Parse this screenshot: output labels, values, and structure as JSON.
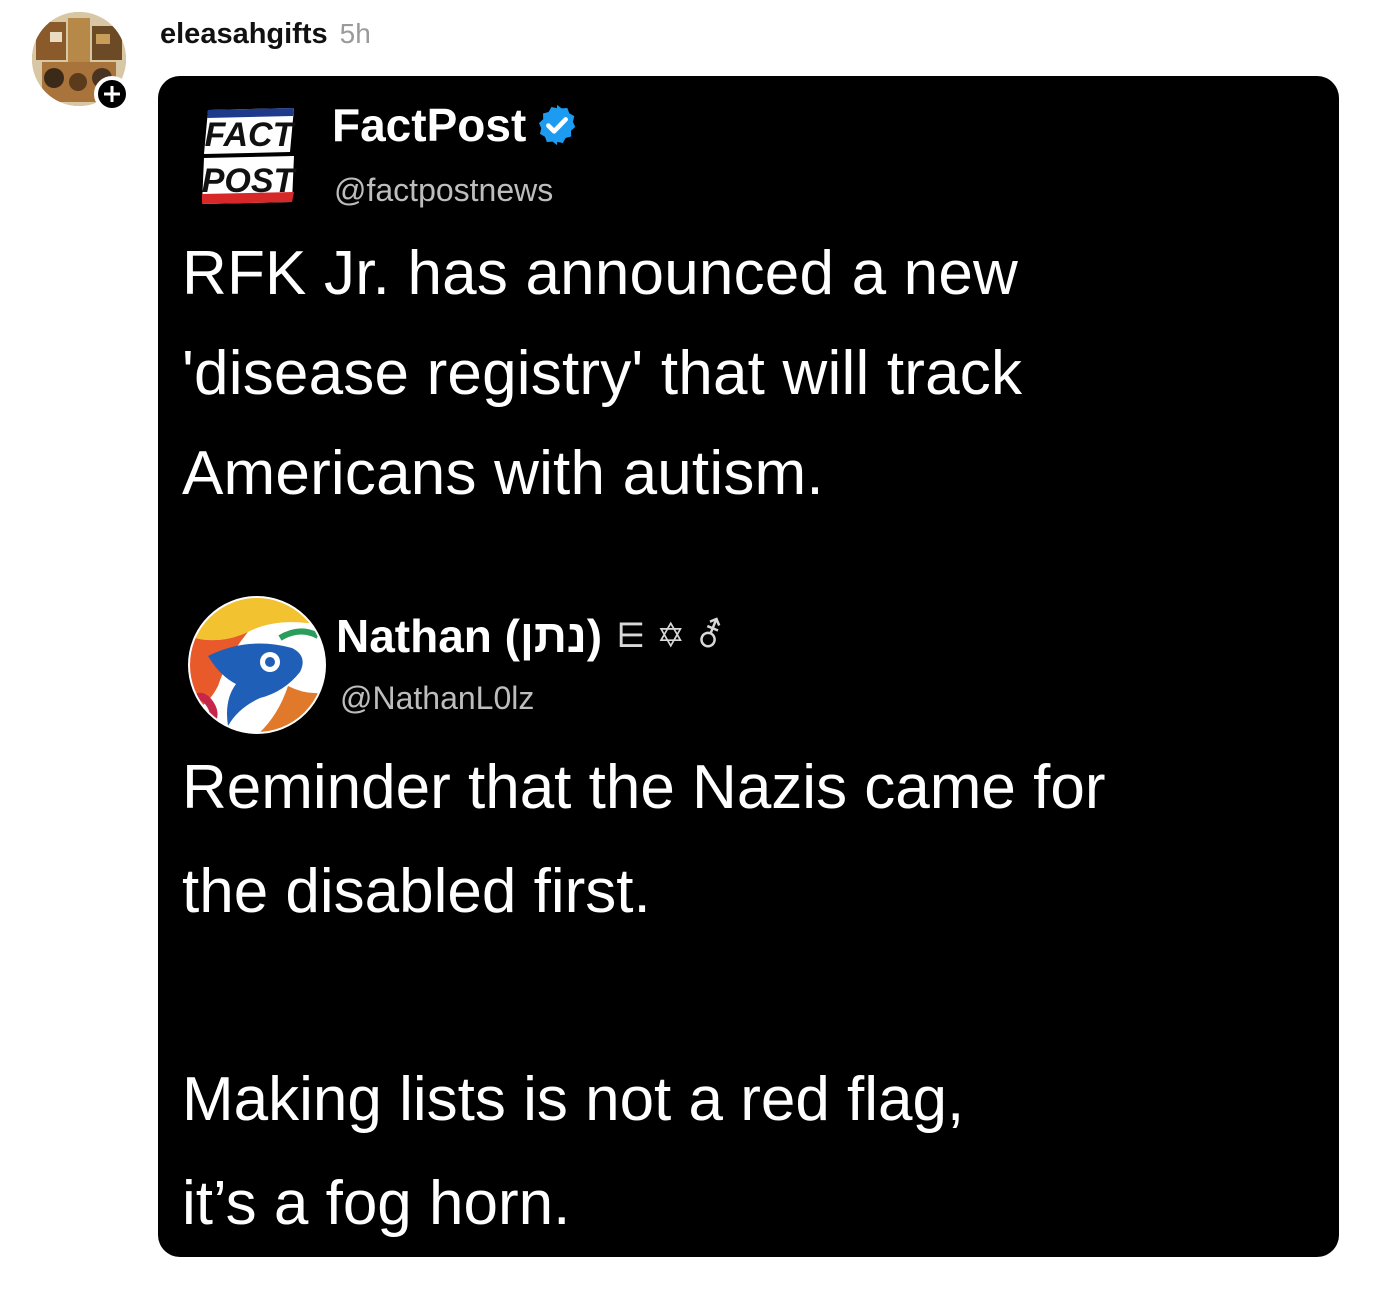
{
  "post": {
    "username": "eleasahgifts",
    "timestamp": "5h",
    "follow_icon": "plus-icon"
  },
  "embedded_image": {
    "first_tweet": {
      "logo_text_line1": "FACT",
      "logo_text_line2": "POST",
      "display_name": "FactPost",
      "verified_icon": "verified-check-icon",
      "handle": "@factpostnews",
      "text_lines": [
        "RFK Jr. has announced a new",
        "'disease registry' that will track",
        "Americans with autism."
      ]
    },
    "second_tweet": {
      "display_name": "Nathan (נתן)",
      "name_symbols": "⋿ ✡ ⚦",
      "handle": "@NathanL0lz",
      "text_lines": [
        "Reminder that the Nazis came for",
        "the disabled first."
      ],
      "text_lines_2": [
        "Making lists is not a red flag,",
        "it’s a fog horn."
      ]
    }
  },
  "colors": {
    "card_background": "#000000",
    "verified_blue": "#1d9bf0",
    "timestamp_gray": "#9a9a9a"
  }
}
